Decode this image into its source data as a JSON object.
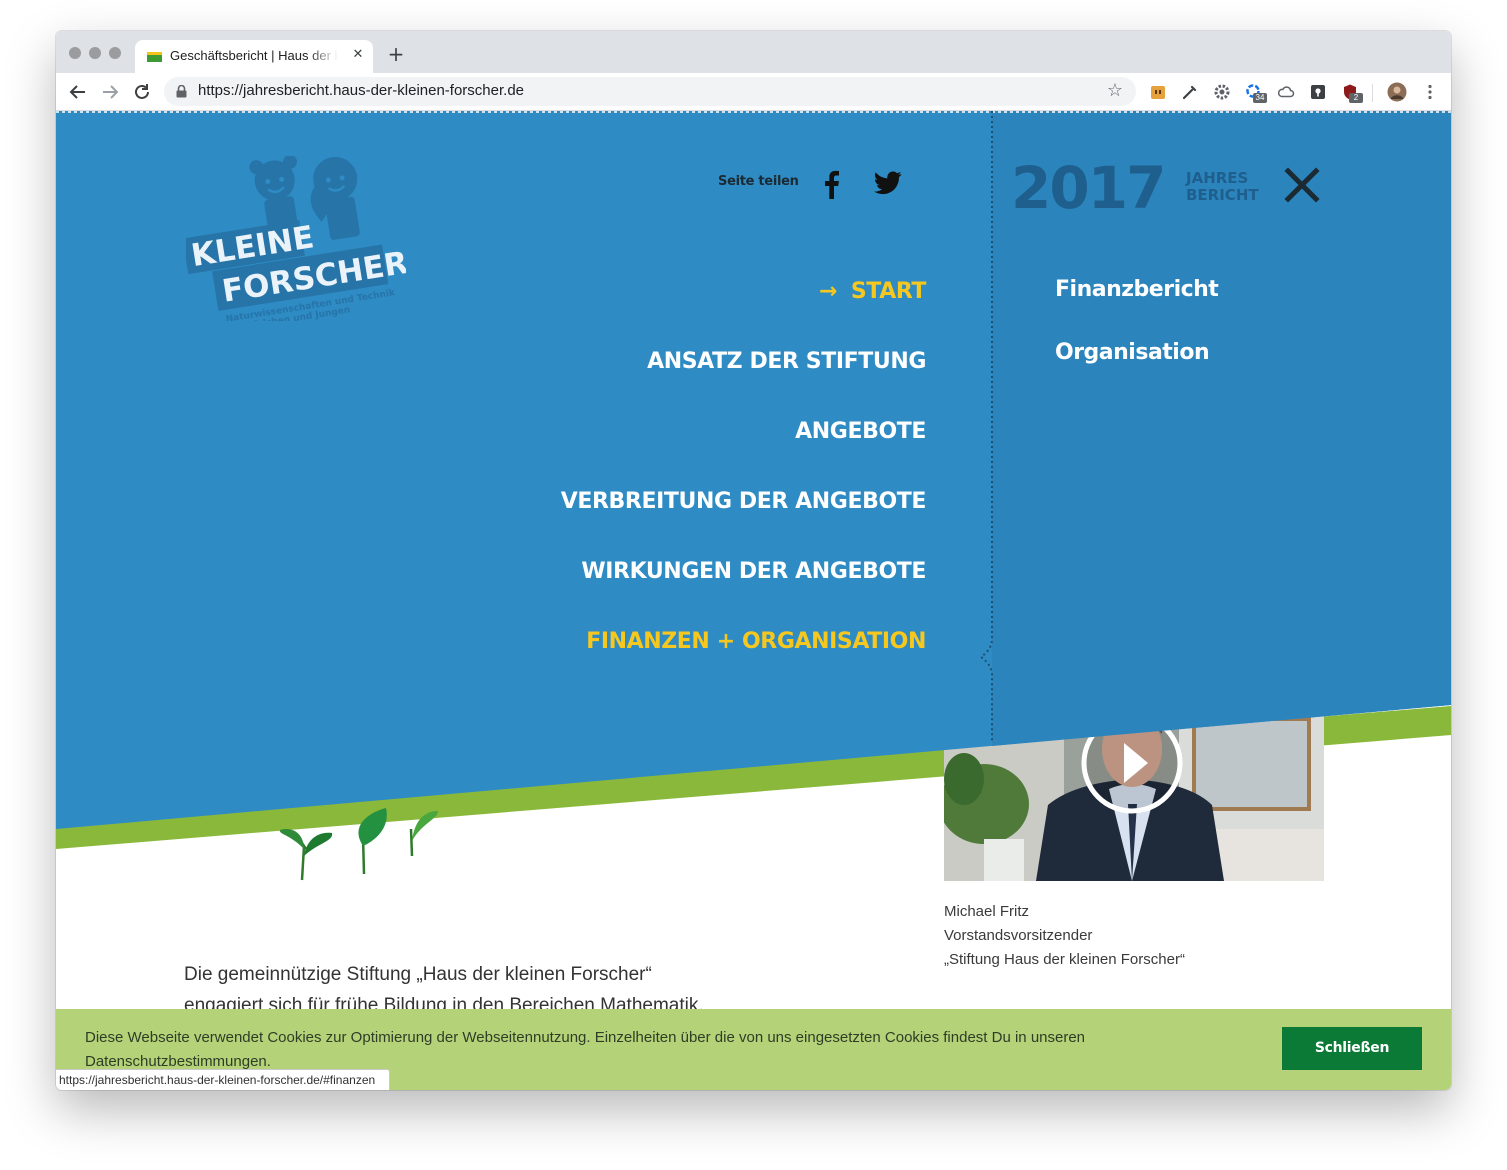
{
  "browser": {
    "tab_title": "Geschäftsbericht | Haus der kleinen Forscher",
    "tab_close": "✕",
    "new_tab": "+",
    "url": "https://jahresbericht.haus-der-kleinen-forscher.de",
    "status_url": "https://jahresbericht.haus-der-kleinen-forscher.de/#finanzen",
    "extension_badges": [
      "34",
      "2"
    ]
  },
  "menu": {
    "logo_text": [
      "KLEINE",
      "FORSCHER"
    ],
    "logo_tagline": [
      "Naturwissenschaften und Technik",
      "für Mädchen und Jungen"
    ],
    "share_label": "Seite teilen",
    "year": "2017",
    "year_sub_1": "JAHRES",
    "year_sub_2": "BERICHT",
    "arrow": "→",
    "main_items": [
      {
        "label": "START",
        "active": true
      },
      {
        "label": "ANSATZ DER STIFTUNG",
        "active": false
      },
      {
        "label": "ANGEBOTE",
        "active": false
      },
      {
        "label": "VERBREITUNG DER ANGEBOTE",
        "active": false
      },
      {
        "label": "WIRKUNGEN DER ANGEBOTE",
        "active": false
      },
      {
        "label": "FINANZEN + ORGANISATION",
        "active": true
      }
    ],
    "sub_items": [
      "Finanzbericht",
      "Organisation"
    ]
  },
  "content": {
    "caption": [
      "Michael Fritz",
      "Vorstandsvorsitzender",
      "„Stiftung Haus der kleinen Forscher“"
    ],
    "intro": [
      "Die gemeinnützige Stiftung „Haus der kleinen Forscher“",
      "engagiert sich für frühe Bildung in den Bereichen Mathematik,"
    ]
  },
  "cookie": {
    "text": "Diese Webseite verwendet Cookies zur Optimierung der Webseitennutzung. Einzelheiten über die von uns eingesetzten Cookies findest Du in unseren Datenschutzbestimmungen.",
    "button": "Schließen"
  },
  "colors": {
    "menu_blue": "#2e8bc4",
    "accent_yellow": "#f6c81f",
    "logo_blue": "#2674a8",
    "green_stripe": "#8ab83b",
    "cookie_green": "#b4d277",
    "button_green": "#0b7a37"
  }
}
